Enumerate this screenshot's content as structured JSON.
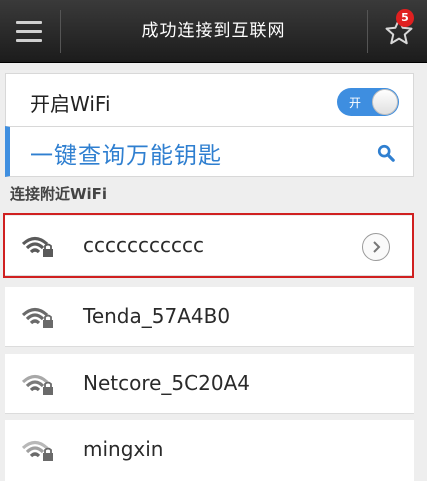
{
  "header": {
    "title": "成功连接到互联网",
    "notification_count": "5"
  },
  "wifi_toggle": {
    "label": "开启WiFi",
    "state_text": "开"
  },
  "master_key": {
    "label": "一键查询万能钥匙"
  },
  "nearby": {
    "section_label": "连接附近WiFi",
    "networks": [
      {
        "name": "ccccccccccc",
        "highlighted": true
      },
      {
        "name": "Tenda_57A4B0"
      },
      {
        "name": "Netcore_5C20A4"
      },
      {
        "name": "mingxin"
      }
    ]
  },
  "colors": {
    "accent": "#3f8fe0",
    "highlight": "#d02020",
    "topbar": "#2a2a2a"
  }
}
